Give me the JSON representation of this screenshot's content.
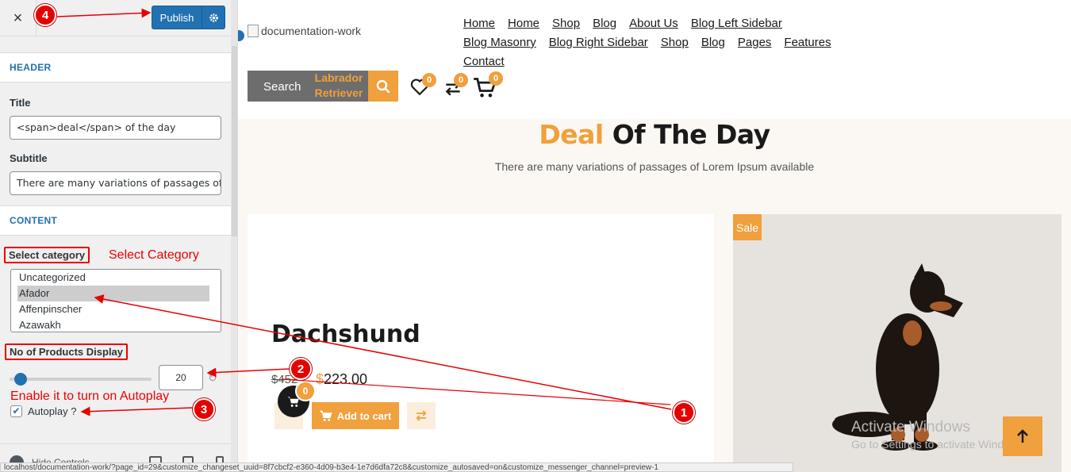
{
  "customizer": {
    "close_label": "×",
    "publish_label": "Publish",
    "sections": {
      "header": "HEADER",
      "content": "CONTENT"
    },
    "fields": {
      "title_label": "Title",
      "title_value": "<span>deal</span> of the day",
      "subtitle_label": "Subtitle",
      "subtitle_value": "There are many variations of passages of Lorem Ipsum available",
      "select_category_label": "Select category",
      "categories": [
        "Uncategorized",
        "Afador",
        "Affenpinscher",
        "Azawakh"
      ],
      "selected_category": "Afador",
      "products_display_label": "No of Products Display",
      "products_display_value": "20",
      "products_display_level": 0.07,
      "autoplay_label": "Autoplay ?",
      "autoplay_checked": true
    },
    "footer": {
      "hide_controls": "Hide Controls"
    }
  },
  "annotations": {
    "select_category_text": "Select Category",
    "autoplay_text": "Enable it to turn on Autoplay",
    "markers": [
      "1",
      "2",
      "3",
      "4"
    ],
    "color": "#e60000"
  },
  "preview": {
    "logo_alt": "documentation-work",
    "nav": [
      "Home",
      "Home",
      "Shop",
      "Blog",
      "About Us",
      "Blog Left Sidebar",
      "Blog Masonry",
      "Blog Right Sidebar",
      "Shop",
      "Blog",
      "Pages",
      "Features",
      "Contact"
    ],
    "search_label": "Search",
    "search_value": "Labrador Retriever",
    "wishlist_count": "0",
    "compare_count": "0",
    "cart_count": "0",
    "deal_title_accent": "Deal",
    "deal_title_rest": "Of The Day",
    "deal_subtitle": "There are many variations of passages of Lorem Ipsum available",
    "product_name": "Dachshund",
    "price_old": "$452",
    "price_currency": "$",
    "price_new": "223.00",
    "add_to_cart": "Add to cart",
    "floating_cart_count": "0",
    "sale_badge": "Sale",
    "watermark_line1": "Activate Windows",
    "watermark_line2": "Go to Settings to activate Windows.",
    "status_url": "localhost/documentation-work/?page_id=29&customize_changeset_uuid=8f7cbcf2-e360-4d09-b3e4-1e7d6dfa72c8&customize_autosaved=on&customize_messenger_channel=preview-1",
    "accent_color": "#f0a03c"
  }
}
